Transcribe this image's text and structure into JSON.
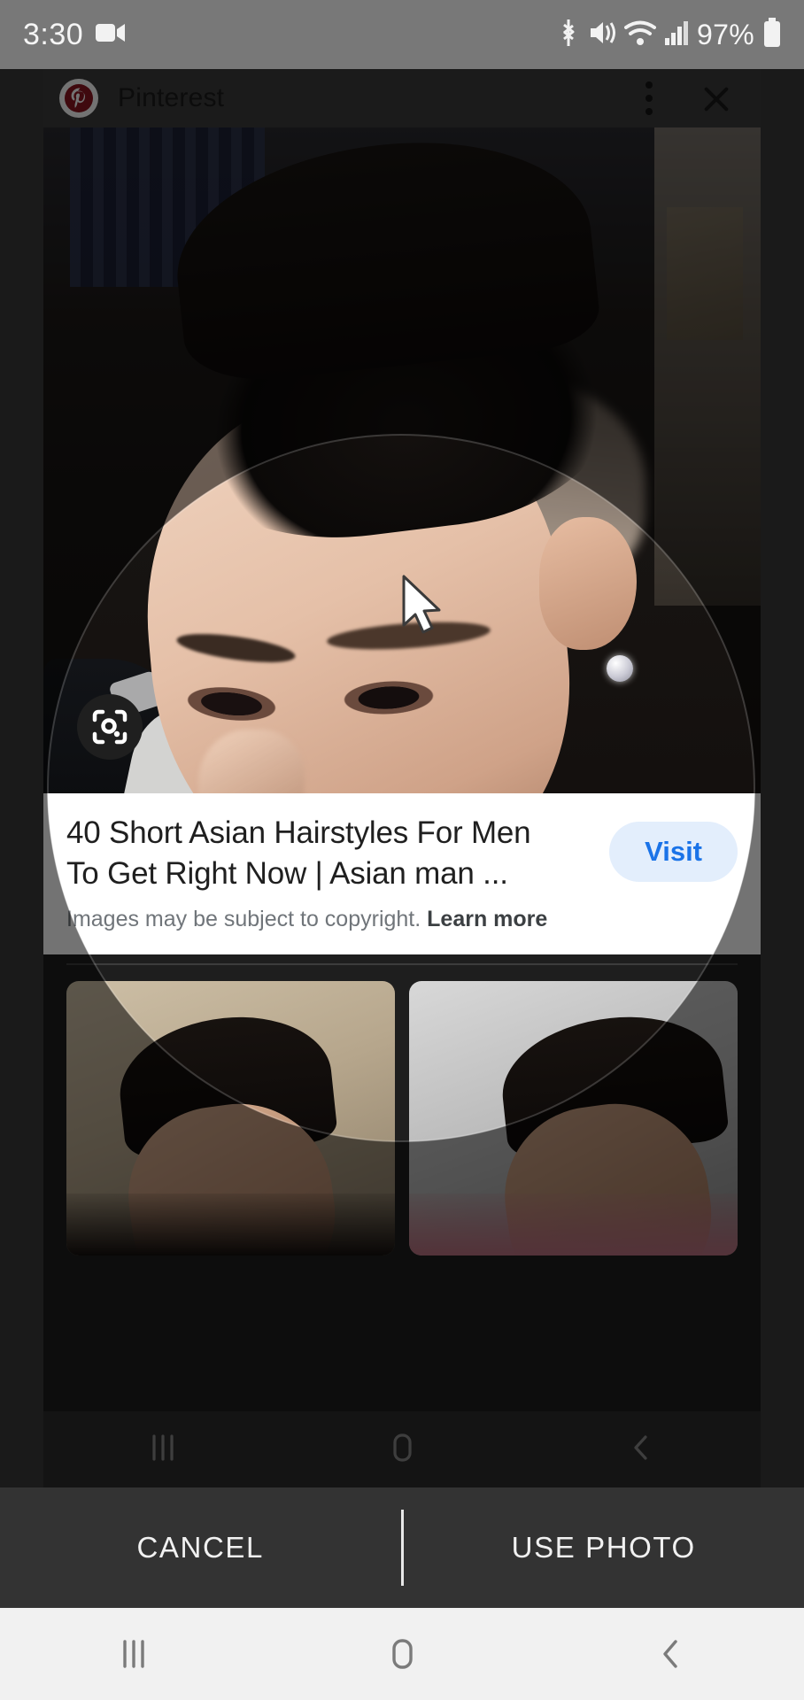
{
  "statusbar": {
    "time": "3:30",
    "battery_percent": "97%",
    "icons": [
      "video-recording-icon",
      "bluetooth-icon",
      "mute-vibrate-icon",
      "wifi-icon",
      "cellular-signal-icon",
      "battery-icon"
    ]
  },
  "card": {
    "source_name": "Pinterest",
    "logo": "pinterest-logo-icon",
    "overflow_label": "More options",
    "close_label": "Close",
    "lens_label": "Search inside image",
    "title": "40 Short Asian Hairstyles For Men To Get Right Now | Asian man ...",
    "visit_label": "Visit",
    "copyright_prefix": "Images may be subject to copyright.",
    "copyright_link": "Learn more"
  },
  "related": {
    "items": [
      {
        "alt": "Short asian hairstyle thumbnail 1"
      },
      {
        "alt": "Short asian hairstyle thumbnail 2"
      }
    ]
  },
  "inner_nav": {
    "recents_label": "Recents",
    "home_label": "Home",
    "back_label": "Back"
  },
  "crop_actions": {
    "cancel_label": "CANCEL",
    "use_label": "USE PHOTO"
  },
  "system_nav": {
    "recents_label": "Recents",
    "home_label": "Home",
    "back_label": "Back"
  },
  "colors": {
    "statusbar_bg": "#787878",
    "dim_overlay": "rgba(0,0,0,0.55)",
    "action_bar_bg": "#333333",
    "system_nav_bg": "#f1f1f1",
    "visit_bg": "#e3eefc",
    "visit_text": "#1a73e8",
    "pinterest_red": "#8c1420"
  }
}
